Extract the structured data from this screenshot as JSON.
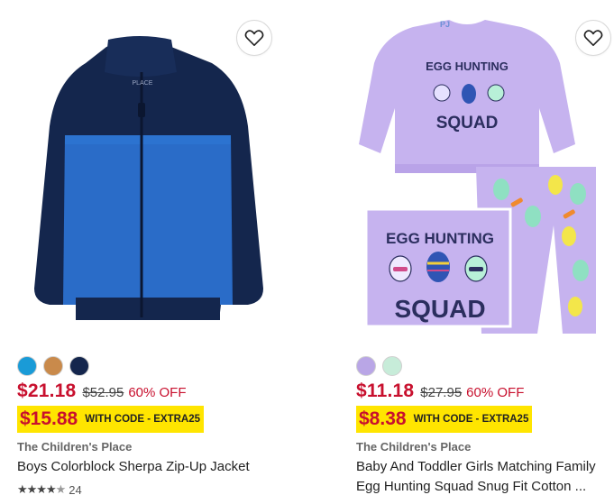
{
  "products": [
    {
      "brand": "The Children's Place",
      "name": "Boys Colorblock Sherpa Zip-Up Jacket",
      "price": "$21.18",
      "original_price": "$52.95",
      "discount": "60% OFF",
      "promo_price": "$15.88",
      "promo_label": "WITH CODE - EXTRA25",
      "swatches": [
        "#1a9bd7",
        "#c98a4b",
        "#14264d"
      ],
      "rating": 4.5,
      "review_count": "24",
      "wishlist_icon": "heart-outline-icon"
    },
    {
      "brand": "The Children's Place",
      "name_line1": "Baby And Toddler Girls Matching Family",
      "name_line2": "Egg Hunting Squad Snug Fit Cotton ...",
      "price": "$11.18",
      "original_price": "$27.95",
      "discount": "60% OFF",
      "promo_price": "$8.38",
      "promo_label": "WITH CODE - EXTRA25",
      "swatches": [
        "#b9a6e6",
        "#c7ecd9"
      ],
      "wishlist_icon": "heart-outline-icon",
      "image_text": {
        "shirt_top": "EGG HUNTING",
        "shirt_bottom": "SQUAD",
        "patch_top": "EGG HUNTING",
        "patch_bottom": "SQUAD"
      }
    }
  ]
}
